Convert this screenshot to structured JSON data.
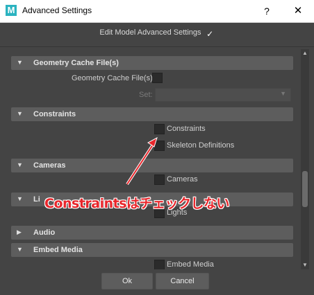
{
  "window": {
    "app_icon_letter": "M",
    "title": "Advanced Settings",
    "help": "?",
    "close": "✕"
  },
  "header": {
    "edit_label": "Edit Model Advanced Settings",
    "edit_checked": true,
    "checkmark": "✓"
  },
  "sections": {
    "geometry": {
      "label": "Geometry Cache File(s)",
      "expanded": true
    },
    "constraints": {
      "label": "Constraints",
      "expanded": true
    },
    "cameras": {
      "label": "Cameras",
      "expanded": true
    },
    "lights": {
      "label": "Li",
      "expanded": true
    },
    "audio": {
      "label": "Audio",
      "expanded": false
    },
    "embed": {
      "label": "Embed Media",
      "expanded": true
    }
  },
  "rows": {
    "geometry_cache": {
      "label": "Geometry Cache File(s)",
      "checked": false
    },
    "set": {
      "label": "Set:",
      "value": ""
    },
    "constraints": {
      "label": "Constraints",
      "checked": false
    },
    "skeleton": {
      "label": "Skeleton Definitions",
      "checked": false
    },
    "cameras": {
      "label": "Cameras",
      "checked": false
    },
    "lights": {
      "label": "Lights",
      "checked": false
    },
    "embed_media": {
      "label": "Embed Media",
      "checked": false
    }
  },
  "buttons": {
    "ok": "Ok",
    "cancel": "Cancel"
  },
  "annotation": {
    "text": "Constraintsはチェックしない",
    "color": "#e8262b"
  },
  "icons": {
    "expanded": "triangle-down-icon",
    "collapsed": "triangle-right-icon",
    "dropdown": "chevron-down-icon"
  }
}
